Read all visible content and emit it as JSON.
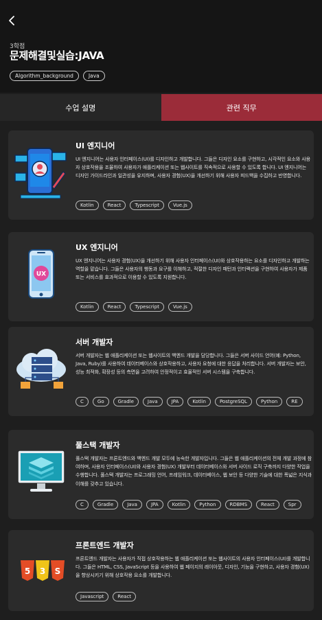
{
  "header": {
    "credit": "3학점",
    "title": "문제해결및실습:JAVA",
    "tags": [
      "Algorithm_background",
      "Java"
    ]
  },
  "tabs": [
    {
      "label": "수업 설명",
      "active": false
    },
    {
      "label": "관련 직무",
      "active": true
    }
  ],
  "colors": {
    "accent": "#9b2c39",
    "background": "#1e1e1e",
    "card": "#2b2b2b"
  },
  "jobs": [
    {
      "icon": "ui-design-illustration",
      "title": "UI 엔지니어",
      "desc": "UI 엔지니어는 사용자 인터페이스(UI)를 디자인하고 개발합니다. 그들은 디자인 요소를 구현하고, 시각적인 요소와 사용자 상호작용을 조율하여 사용자가 애플리케이션 또는 웹사이트를 직속적으로 사용할 수 있도록 합니다. UI 엔지니어는 디자인 가이드라인과 일관성을 유지하며, 사용자 경험(UX)을 개선하기 위해 사용자 피드백을 수집하고 반영합니다.",
      "skills": [
        "Kotlin",
        "React",
        "Typescript",
        "Vue.js"
      ]
    },
    {
      "icon": "ux-phone-illustration",
      "title": "UX 엔지니어",
      "desc": "UX 엔지니어는 사용자 경험(UX)을 개선하기 위해 사용자 인터페이스(UI)와 상호작용하는 요소를 디자인하고 개발하는 역할을 맡습니다. 그들은 사용자의 행동과 요구를 이해하고, 적절한 디자인 패턴과 인터랙션을 구현하여 사용자가 제품 또는 서비스를 효과적으로 이용할 수 있도록 지원합니다.",
      "skills": [
        "Kotlin",
        "React",
        "Typescript",
        "Vue.js"
      ]
    },
    {
      "icon": "server-cloud-illustration",
      "title": "서버 개발자",
      "desc": "서버 개발자는 웹 애플리케이션 또는 웹사이트의 백엔드 개발을 담당합니다. 그들은 서버 사이드 언어(예: Python, Java, Ruby)를 사용하여 데이터베이스와 상호작용하고, 사용자 요청에 대한 응답을 처리합니다. 서버 개발자는 보안, 성능 최적화, 확장성 등의 측면을 고려하여 안정적이고 효율적인 서버 시스템을 구축합니다.",
      "skills": [
        "C",
        "Go",
        "Gradle",
        "Java",
        "JPA",
        "Kotlin",
        "PostgreSQL",
        "Python",
        "RE"
      ]
    },
    {
      "icon": "fullstack-monitor-illustration",
      "title": "풀스택 개발자",
      "desc": "풀스택 개발자는 프론트엔드와 백엔드 개발 모두에 능숙한 개발자입니다. 그들은 웹 애플리케이션의 전체 개발 과정에 참여하며, 사용자 인터페이스(UI)와 사용자 경험(UX) 개발부터 데이터베이스와 서버 사이드 로직 구축까지 다양한 작업을 수행합니다. 풀스택 개발자는 프로그래밍 언어, 프레임워크, 데이터베이스, 웹 보안 등 다양한 기술에 대한 폭넓은 지식과 이해를 갖추고 있습니다.",
      "skills": [
        "C",
        "Gradle",
        "Java",
        "JPA",
        "Kotlin",
        "Python",
        "RDBMS",
        "React",
        "Spr"
      ]
    },
    {
      "icon": "html-css-js-icons",
      "title": "프론트엔드 개발자",
      "desc": "프론트엔드 개발자는 사용자가 직접 상호작용하는 웹 애플리케이션 또는 웹사이트의 사용자 인터페이스(UI)를 개발합니다. 그들은 HTML, CSS, JavaScript 등을 사용하여 웹 페이지의 레이아웃, 디자인, 기능을 구현하고, 사용자 경험(UX)을 향상시키기 위해 상호작용 요소를 개발합니다.",
      "skills": [
        "Javascript",
        "React"
      ]
    }
  ]
}
